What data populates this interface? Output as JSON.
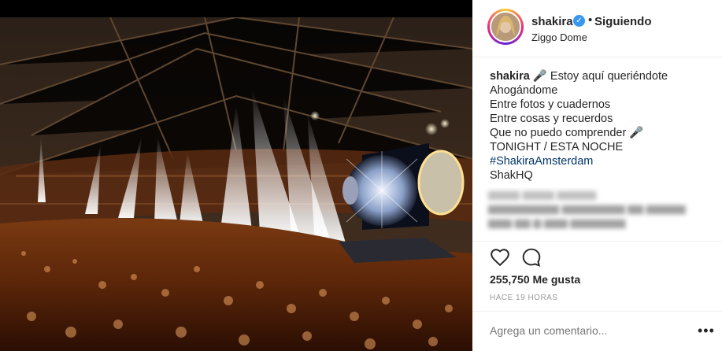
{
  "post": {
    "image_alt": "Concierto de Shakira en el Ziggo Dome",
    "username": "shakira",
    "follow_status": "Siguiendo",
    "location": "Ziggo Dome",
    "caption": {
      "user": "shakira",
      "lines": [
        "🎤 Estoy aquí queriéndote",
        "Ahogándome",
        "Entre fotos y cuadernos",
        "Entre cosas y recuerdos",
        "Que no puedo comprender 🎤",
        "TONIGHT / ESTA NOCHE",
        "#ShakiraAmsterdam",
        "ShakHQ"
      ]
    },
    "likes": "255,750 Me gusta",
    "time_ago": "HACE 19 HORAS",
    "comment_placeholder": "Agrega un comentario...",
    "more_label": "•••"
  },
  "icons": {
    "verified": "verified-badge-icon",
    "like": "heart-icon",
    "comment": "comment-bubble-icon",
    "more": "more-dots-icon"
  },
  "colors": {
    "text": "#262626",
    "muted": "#999999",
    "verified": "#3897f0",
    "hashtag": "#003569"
  }
}
